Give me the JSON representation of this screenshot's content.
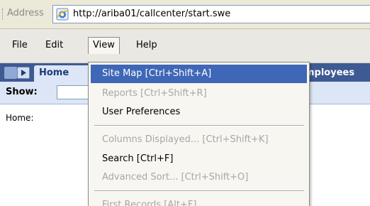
{
  "address_bar": {
    "label": "Address",
    "url": "http://ariba01/callcenter/start.swe"
  },
  "menu_bar": {
    "items": [
      {
        "label": "File"
      },
      {
        "label": "Edit"
      },
      {
        "label": "View"
      },
      {
        "label": "Help"
      }
    ],
    "active": "View"
  },
  "app_tabs": {
    "home_label": "Home",
    "employees_label": "mployees"
  },
  "show_row": {
    "label": "Show:"
  },
  "content": {
    "breadcrumb": "Home:"
  },
  "view_menu": {
    "items": [
      {
        "label": "Site Map  [Ctrl+Shift+A]",
        "state": "highlighted"
      },
      {
        "label": "Reports  [Ctrl+Shift+R]",
        "state": "disabled"
      },
      {
        "label": "User Preferences",
        "state": "enabled"
      },
      {
        "label": "Columns Displayed...  [Ctrl+Shift+K]",
        "state": "disabled"
      },
      {
        "label": "Search  [Ctrl+F]",
        "state": "enabled"
      },
      {
        "label": "Advanced Sort...  [Ctrl+Shift+O]",
        "state": "disabled"
      },
      {
        "label": "First Records  [Alt+F]",
        "state": "disabled"
      }
    ]
  },
  "colors": {
    "menu_highlight": "#3f67b7",
    "tab_strip": "#3e5a93",
    "tab_active": "#dde6f6",
    "disabled_text": "#a7a7a7"
  }
}
